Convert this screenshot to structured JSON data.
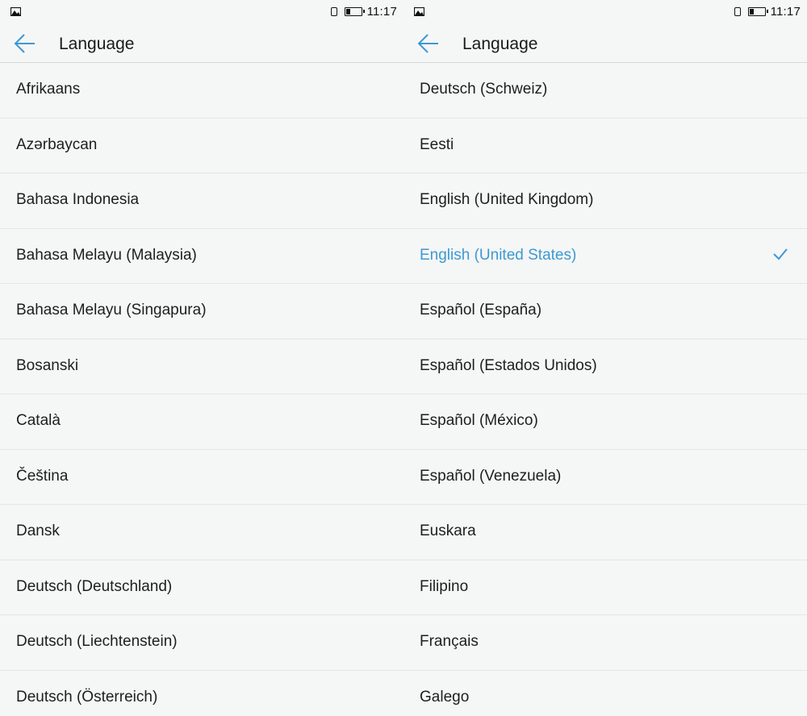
{
  "colors": {
    "accent": "#3c9ad3",
    "text": "#1e1e1e",
    "background": "#f5f6f6"
  },
  "screens": [
    {
      "status_bar": {
        "time": "11:17",
        "left_icon": "image-notification-icon",
        "sim_icon": "sim-card-icon",
        "battery_icon": "battery-low-icon"
      },
      "header": {
        "back_icon": "arrow-left-icon",
        "title": "Language"
      },
      "languages": [
        {
          "label": "Afrikaans"
        },
        {
          "label": "Azərbaycan"
        },
        {
          "label": "Bahasa Indonesia"
        },
        {
          "label": "Bahasa Melayu (Malaysia)"
        },
        {
          "label": "Bahasa Melayu (Singapura)"
        },
        {
          "label": "Bosanski"
        },
        {
          "label": "Català"
        },
        {
          "label": "Čeština"
        },
        {
          "label": "Dansk"
        },
        {
          "label": "Deutsch (Deutschland)"
        },
        {
          "label": "Deutsch (Liechtenstein)"
        },
        {
          "label": "Deutsch (Österreich)"
        }
      ]
    },
    {
      "status_bar": {
        "time": "11:17",
        "left_icon": "image-notification-icon",
        "sim_icon": "sim-card-icon",
        "battery_icon": "battery-low-icon"
      },
      "header": {
        "back_icon": "arrow-left-icon",
        "title": "Language"
      },
      "languages": [
        {
          "label": "Deutsch (Schweiz)"
        },
        {
          "label": "Eesti"
        },
        {
          "label": "English (United Kingdom)"
        },
        {
          "label": "English (United States)",
          "selected": true,
          "check_icon": "checkmark-icon"
        },
        {
          "label": "Español (España)"
        },
        {
          "label": "Español (Estados Unidos)"
        },
        {
          "label": "Español (México)"
        },
        {
          "label": "Español (Venezuela)"
        },
        {
          "label": "Euskara"
        },
        {
          "label": "Filipino"
        },
        {
          "label": "Français"
        },
        {
          "label": "Galego"
        }
      ]
    }
  ]
}
